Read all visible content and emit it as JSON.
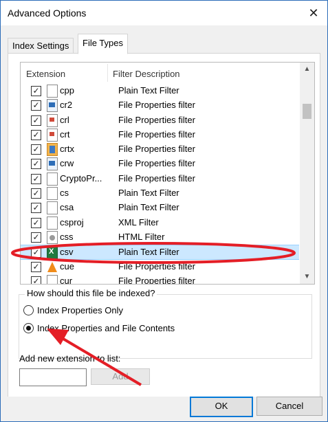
{
  "window": {
    "title": "Advanced Options",
    "close_glyph": "✕"
  },
  "tabs": [
    {
      "label": "Index Settings"
    },
    {
      "label": "File Types"
    }
  ],
  "list": {
    "headers": {
      "extension": "Extension",
      "filter": "Filter Description"
    },
    "rows": [
      {
        "ext": "cpp",
        "filter": "Plain Text Filter",
        "icon": "document-icon",
        "checked": true
      },
      {
        "ext": "cr2",
        "filter": "File Properties filter",
        "icon": "image-file-icon",
        "checked": true
      },
      {
        "ext": "crl",
        "filter": "File Properties filter",
        "icon": "certificate-file-icon",
        "checked": true
      },
      {
        "ext": "crt",
        "filter": "File Properties filter",
        "icon": "certificate-icon",
        "checked": true
      },
      {
        "ext": "crtx",
        "filter": "File Properties filter",
        "icon": "chart-template-icon",
        "checked": true
      },
      {
        "ext": "crw",
        "filter": "File Properties filter",
        "icon": "image-file-icon",
        "checked": true
      },
      {
        "ext": "CryptoPr...",
        "filter": "File Properties filter",
        "icon": "document-icon",
        "checked": true
      },
      {
        "ext": "cs",
        "filter": "Plain Text Filter",
        "icon": "document-icon",
        "checked": true
      },
      {
        "ext": "csa",
        "filter": "Plain Text Filter",
        "icon": "document-icon",
        "checked": true
      },
      {
        "ext": "csproj",
        "filter": "XML Filter",
        "icon": "document-icon",
        "checked": true
      },
      {
        "ext": "css",
        "filter": "HTML Filter",
        "icon": "settings-file-icon",
        "checked": true
      },
      {
        "ext": "csv",
        "filter": "Plain Text Filter",
        "icon": "excel-file-icon",
        "checked": true,
        "selected": true
      },
      {
        "ext": "cue",
        "filter": "File Properties filter",
        "icon": "vlc-cone-icon",
        "checked": true
      },
      {
        "ext": "cur",
        "filter": "File Properties filter",
        "icon": "document-icon",
        "checked": true
      }
    ]
  },
  "indexing": {
    "question": "How should this file be indexed?",
    "options": [
      {
        "label": "Index Properties Only",
        "selected": false
      },
      {
        "label": "Index Properties and File Contents",
        "selected": true
      }
    ]
  },
  "add_extension": {
    "label": "Add new extension to list:",
    "value": "",
    "button": "Add"
  },
  "footer": {
    "ok": "OK",
    "cancel": "Cancel"
  },
  "annotation_color": "#e41e26"
}
